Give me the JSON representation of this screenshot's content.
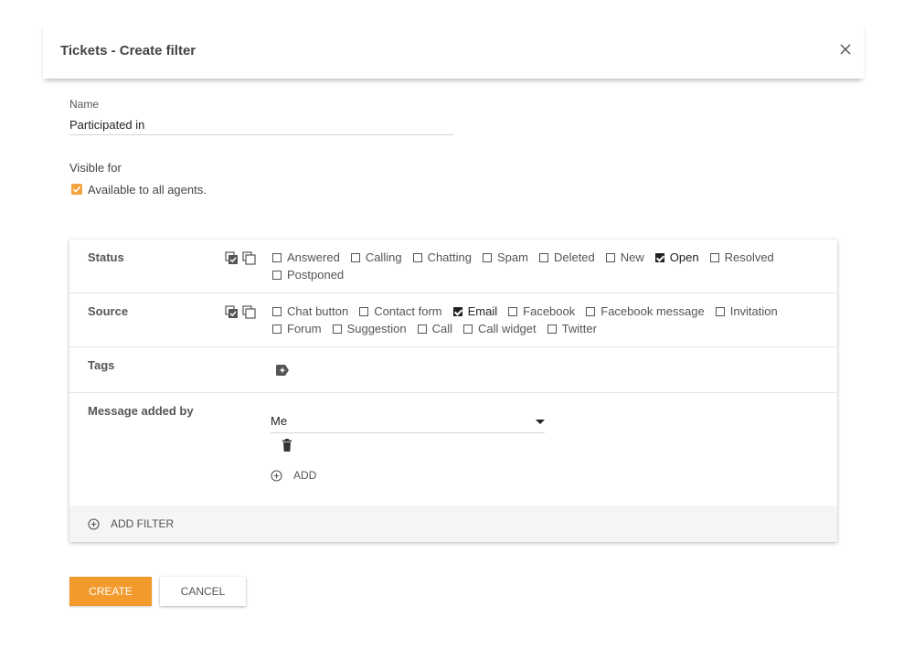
{
  "dialog": {
    "title": "Tickets - Create filter"
  },
  "name_field": {
    "label": "Name",
    "value": "Participated in"
  },
  "visibility": {
    "label": "Visible for",
    "checkbox_label": "Available to all agents.",
    "checked": true
  },
  "filters": {
    "status": {
      "label": "Status",
      "line1": [
        {
          "label": "Answered",
          "checked": false
        },
        {
          "label": "Calling",
          "checked": false
        },
        {
          "label": "Chatting",
          "checked": false
        },
        {
          "label": "Spam",
          "checked": false
        },
        {
          "label": "Deleted",
          "checked": false
        },
        {
          "label": "New",
          "checked": false
        },
        {
          "label": "Open",
          "checked": true
        },
        {
          "label": "Resolved",
          "checked": false
        }
      ],
      "line2": [
        {
          "label": "Postponed",
          "checked": false
        }
      ]
    },
    "source": {
      "label": "Source",
      "line1": [
        {
          "label": "Chat button",
          "checked": false
        },
        {
          "label": "Contact form",
          "checked": false
        },
        {
          "label": "Email",
          "checked": true
        },
        {
          "label": "Facebook",
          "checked": false
        },
        {
          "label": "Facebook message",
          "checked": false
        },
        {
          "label": "Invitation",
          "checked": false
        }
      ],
      "line2": [
        {
          "label": "Forum",
          "checked": false
        },
        {
          "label": "Suggestion",
          "checked": false
        },
        {
          "label": "Call",
          "checked": false
        },
        {
          "label": "Call widget",
          "checked": false
        },
        {
          "label": "Twitter",
          "checked": false
        }
      ]
    },
    "tags": {
      "label": "Tags"
    },
    "message_added_by": {
      "label": "Message added by",
      "selected": "Me",
      "add_label": "ADD"
    },
    "add_filter_label": "ADD FILTER"
  },
  "actions": {
    "create_label": "CREATE",
    "cancel_label": "CANCEL"
  },
  "colors": {
    "accent": "#f39a2d",
    "checkbox_accent": "#f3a23c"
  }
}
